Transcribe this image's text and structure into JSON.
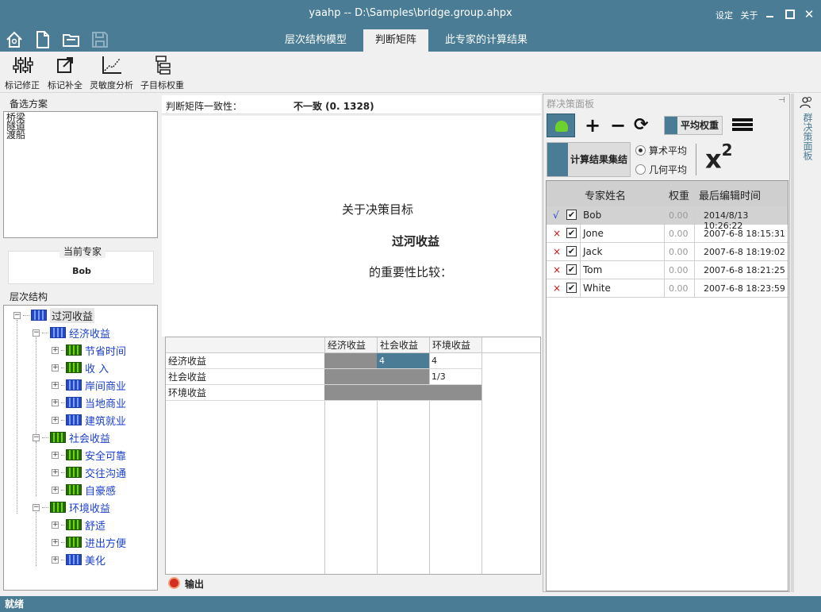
{
  "window": {
    "title": "yaahp -- D:\\Samples\\bridge.group.ahpx",
    "settings": "设定",
    "about": "关于"
  },
  "tabs": [
    {
      "label": "层次结构模型"
    },
    {
      "label": "判断矩阵"
    },
    {
      "label": "此专家的计算结果"
    }
  ],
  "toolbar": {
    "items": [
      {
        "label": "标记修正"
      },
      {
        "label": "标记补全"
      },
      {
        "label": "灵敏度分析"
      },
      {
        "label": "子目标权重"
      }
    ]
  },
  "left": {
    "alternatives_label": "备选方案",
    "alternatives": [
      "桥梁",
      "隧道",
      "渡船"
    ],
    "current_expert_label": "当前专家",
    "current_expert": "Bob",
    "hierarchy_label": "层次结构",
    "tree": {
      "root": "过河收益",
      "n1": "经济收益",
      "n1a": "节省时间",
      "n1b": "收  入",
      "n1c": "岸间商业",
      "n1d": "当地商业",
      "n1e": "建筑就业",
      "n2": "社会收益",
      "n2a": "安全可靠",
      "n2b": "交往沟通",
      "n2c": "自豪感",
      "n3": "环境收益",
      "n3a": "舒适",
      "n3b": "进出方便",
      "n3c": "美化"
    }
  },
  "center": {
    "consistency_label": "判断矩阵一致性：",
    "consistency_value": "不一致 (0. 1328)",
    "prompt_line1": "关于决策目标",
    "prompt_goal": "过河收益",
    "prompt_line3": "的重要性比较：",
    "matrix": {
      "columns": [
        "经济收益",
        "社会收益",
        "环境收益"
      ],
      "rows": [
        "经济收益",
        "社会收益",
        "环境收益"
      ],
      "cells": [
        [
          "",
          "4",
          "4"
        ],
        [
          "",
          "",
          "1/3"
        ],
        [
          "",
          "",
          ""
        ]
      ]
    },
    "output_label": "输出"
  },
  "right": {
    "panel_title": "群决策面板",
    "avg_weight": "平均权重",
    "calc_aggregate": "计算结果集结",
    "arith_mean": "算术平均",
    "geo_mean": "几何平均",
    "chi_label": "x",
    "chi_exp": "2",
    "vertical_tab": "群决策面板",
    "table": {
      "headers": {
        "name": "专家姓名",
        "weight": "权重",
        "edited": "最后编辑时间"
      },
      "rows": [
        {
          "mark": "√",
          "checked": "✔",
          "name": "Bob",
          "weight": "0.00",
          "edited": "2014/8/13 10:26:22"
        },
        {
          "mark": "×",
          "checked": "✔",
          "name": "Jone",
          "weight": "0.00",
          "edited": "2007-6-8 18:15:31"
        },
        {
          "mark": "×",
          "checked": "✔",
          "name": "Jack",
          "weight": "0.00",
          "edited": "2007-6-8 18:19:02"
        },
        {
          "mark": "×",
          "checked": "✔",
          "name": "Tom",
          "weight": "0.00",
          "edited": "2007-6-8 18:21:25"
        },
        {
          "mark": "×",
          "checked": "✔",
          "name": "White",
          "weight": "0.00",
          "edited": "2007-6-8 18:23:59"
        }
      ]
    }
  },
  "status": {
    "text": "就绪"
  },
  "colors": {
    "accent": "#4a7d95",
    "matrix_gray": "#8e8e8e",
    "reject_red": "#d01010",
    "tree_blue": "#1a3fd0"
  }
}
